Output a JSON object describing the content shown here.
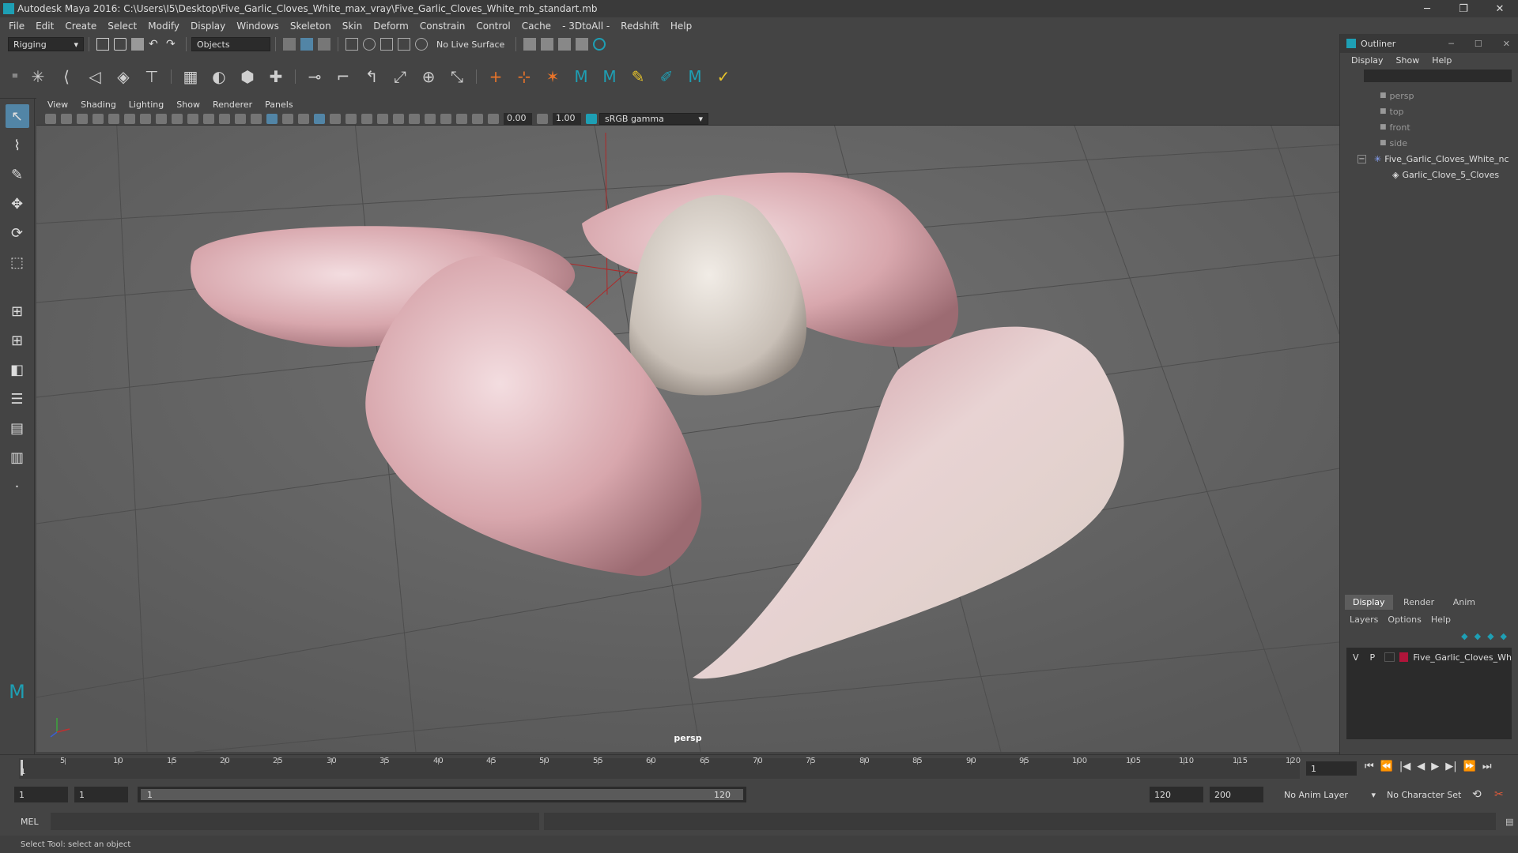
{
  "window": {
    "title": "Autodesk Maya 2016: C:\\Users\\I5\\Desktop\\Five_Garlic_Cloves_White_max_vray\\Five_Garlic_Cloves_White_mb_standart.mb",
    "minimize": "─",
    "restore": "❐",
    "close": "✕"
  },
  "menubar": [
    "File",
    "Edit",
    "Create",
    "Select",
    "Modify",
    "Display",
    "Windows",
    "Skeleton",
    "Skin",
    "Deform",
    "Constrain",
    "Control",
    "Cache",
    "- 3DtoAll -",
    "Redshift",
    "Help"
  ],
  "statusline": {
    "mode": "Rigging",
    "selection_mask": "Objects",
    "live_surface": "No Live Surface"
  },
  "viewport": {
    "menu": [
      "View",
      "Shading",
      "Lighting",
      "Show",
      "Renderer",
      "Panels"
    ],
    "exposure": "0.00",
    "gamma": "1.00",
    "color_space": "sRGB gamma",
    "camera_label": "persp"
  },
  "outliner": {
    "title": "Outliner",
    "menu": [
      "Display",
      "Show",
      "Help"
    ],
    "items": [
      {
        "label": "persp",
        "type": "camera"
      },
      {
        "label": "top",
        "type": "camera"
      },
      {
        "label": "front",
        "type": "camera"
      },
      {
        "label": "side",
        "type": "camera"
      },
      {
        "label": "Five_Garlic_Cloves_White_nc",
        "type": "group"
      },
      {
        "label": "Garlic_Clove_5_Cloves",
        "type": "mesh"
      }
    ]
  },
  "layers": {
    "tabs": [
      "Display",
      "Render",
      "Anim"
    ],
    "menu": [
      "Layers",
      "Options",
      "Help"
    ],
    "layer_v": "V",
    "layer_p": "P",
    "layer_name": "Five_Garlic_Cloves_Wh",
    "layer_color": "#b0153a"
  },
  "timeline": {
    "ticks": [
      "5",
      "10",
      "15",
      "20",
      "25",
      "30",
      "35",
      "40",
      "45",
      "50",
      "55",
      "60",
      "65",
      "70",
      "75",
      "80",
      "85",
      "90",
      "95",
      "100",
      "105",
      "110",
      "115",
      "120"
    ],
    "current_frame": "1",
    "start_tick": "1"
  },
  "range": {
    "start": "1",
    "playback_start": "1",
    "slider_start": "1",
    "slider_end": "120",
    "playback_end": "120",
    "end": "200",
    "anim_layer": "No Anim Layer",
    "character_set": "No Character Set"
  },
  "cmdline": {
    "lang": "MEL"
  },
  "helpline": {
    "text": "Select Tool: select an object"
  },
  "colors": {
    "accent": "#5285a6",
    "maya_teal": "#1e9fb4"
  }
}
